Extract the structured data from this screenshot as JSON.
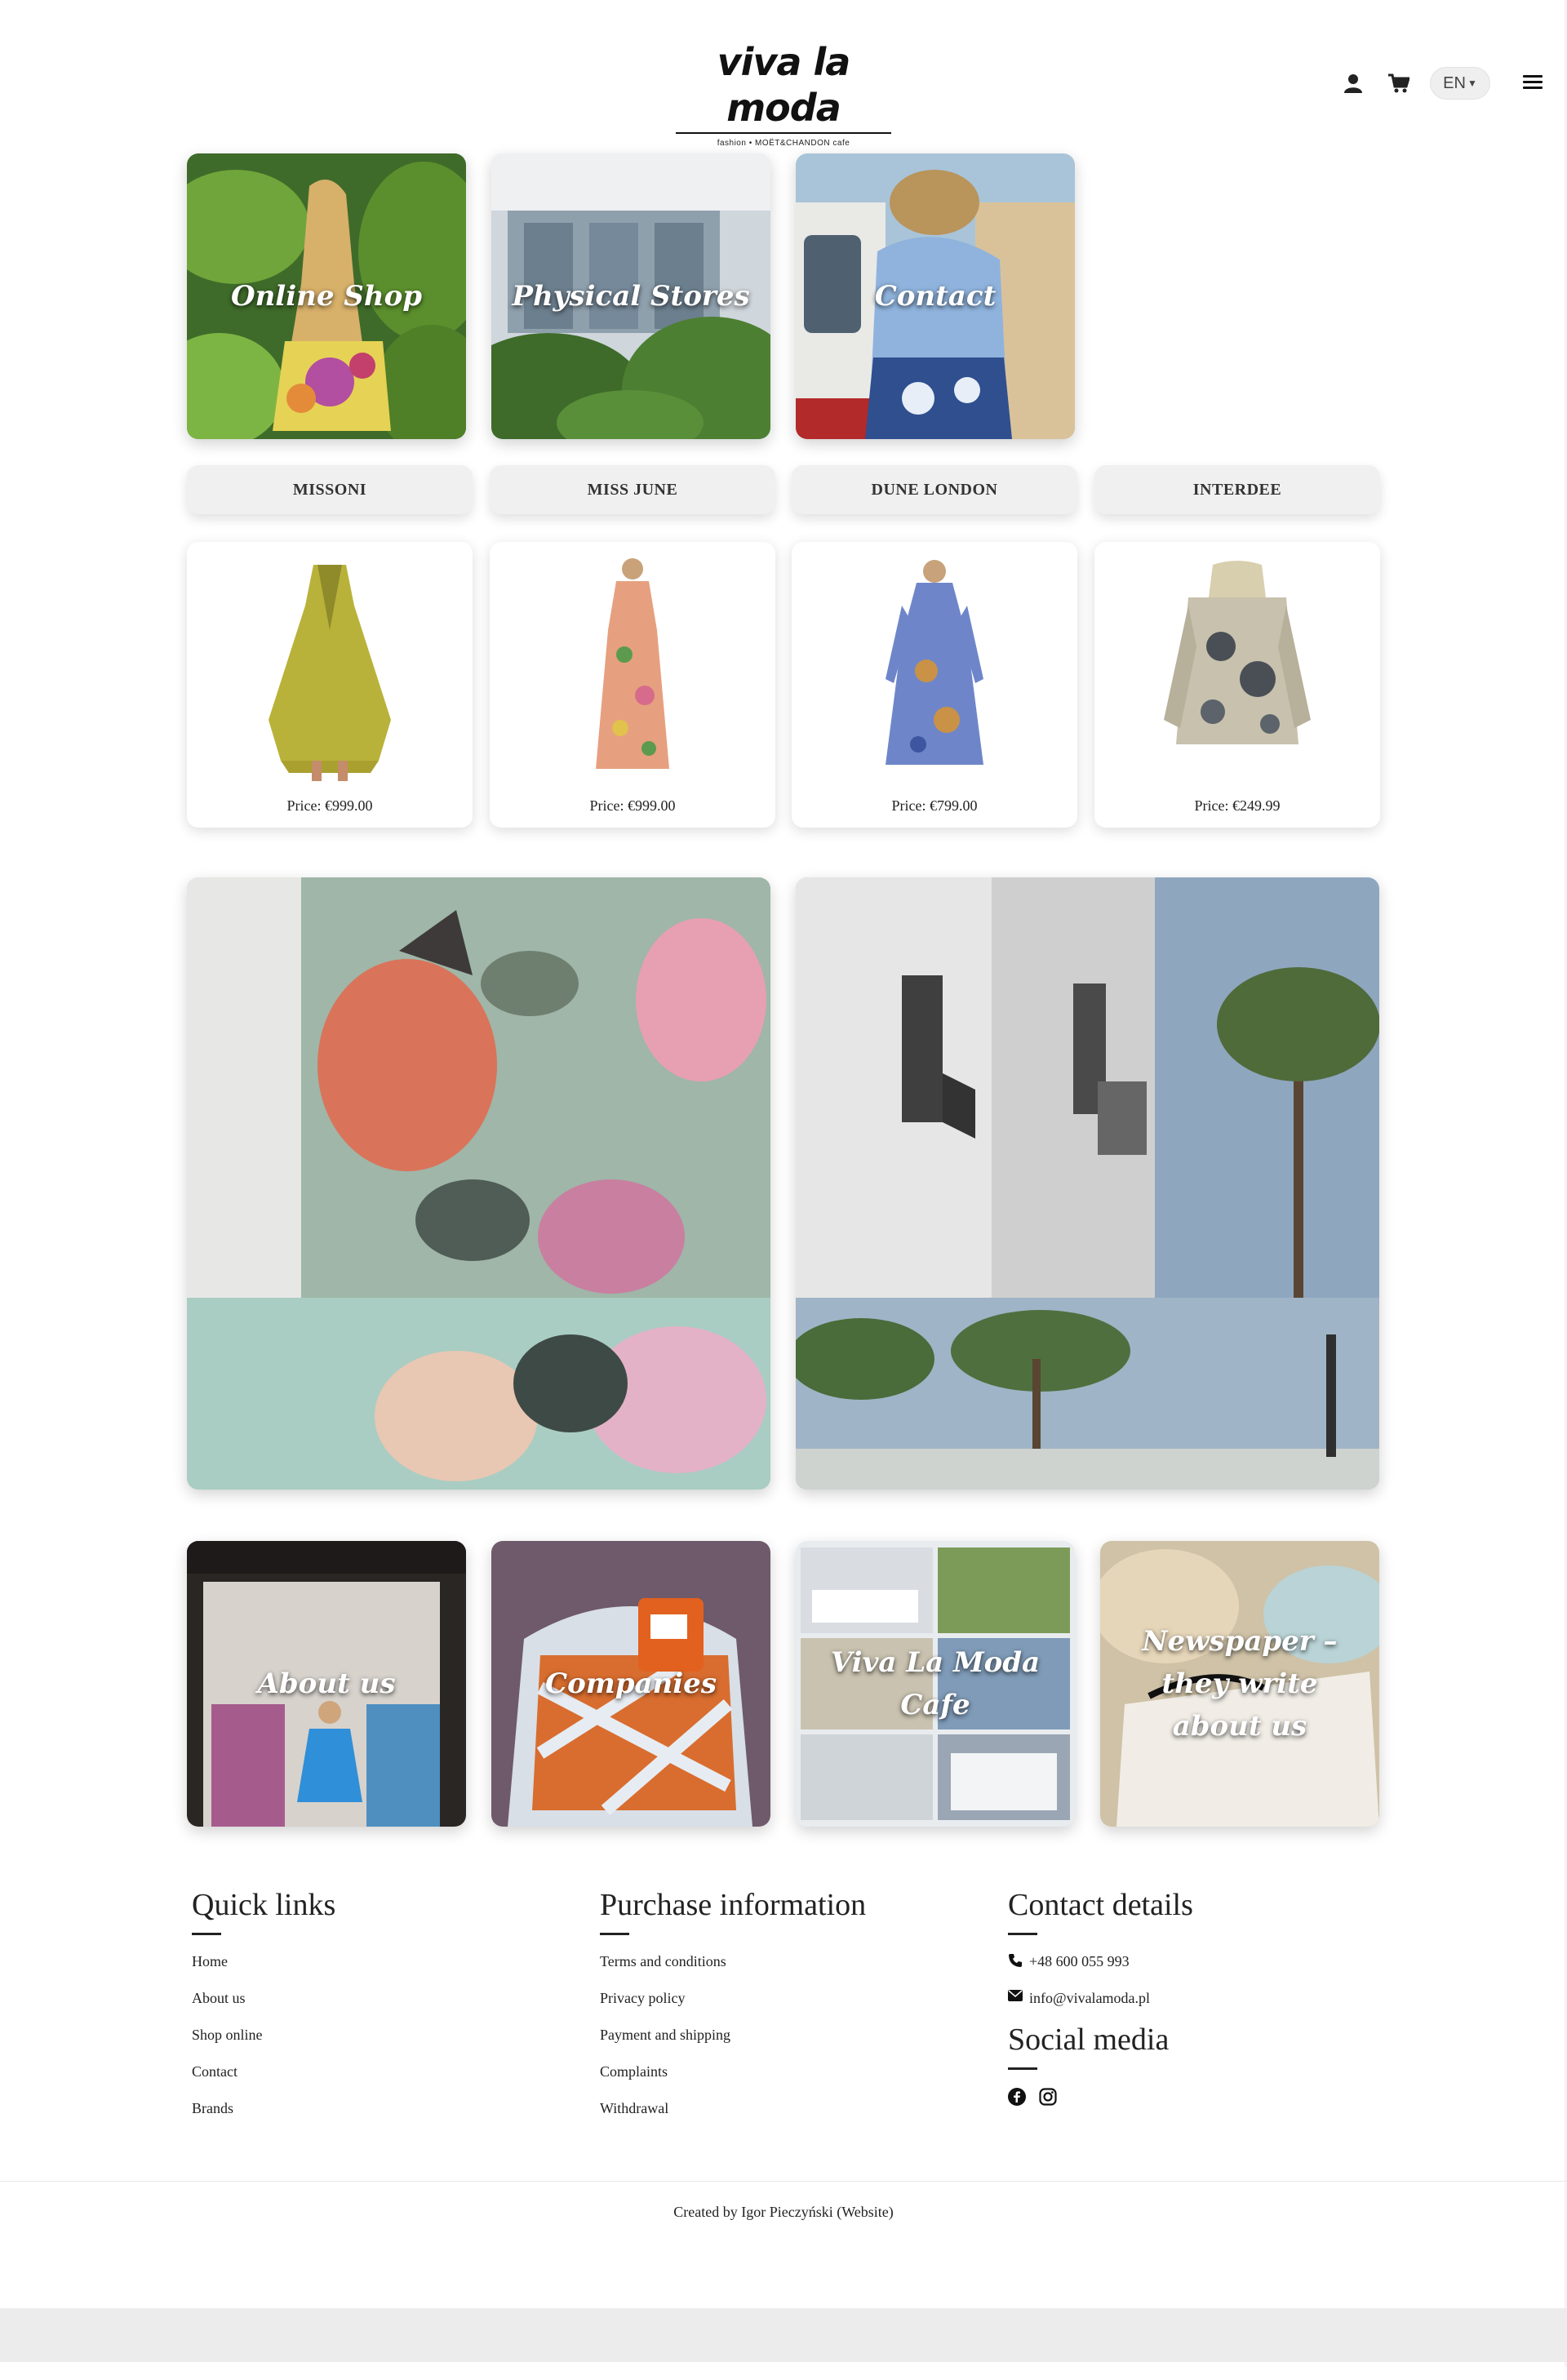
{
  "header": {
    "logo_text": "viva la moda",
    "logo_tagline": "fashion • MOËT&CHANDON cafe",
    "language": "EN",
    "icons": [
      "user-icon",
      "cart-icon",
      "chevron-down-icon",
      "menu-icon"
    ]
  },
  "nav_tiles": [
    {
      "label": "Online Shop"
    },
    {
      "label": "Physical Stores"
    },
    {
      "label": "Contact"
    }
  ],
  "brands": [
    "MISSONI",
    "MISS JUNE",
    "DUNE LONDON",
    "INTERDEE"
  ],
  "products": [
    {
      "price": "Price: €999.00"
    },
    {
      "price": "Price: €999.00"
    },
    {
      "price": "Price: €799.00"
    },
    {
      "price": "Price: €249.99"
    }
  ],
  "bottom_tiles": [
    {
      "label": "About us"
    },
    {
      "label": "Companies"
    },
    {
      "label": "Viva La Moda Cafe"
    },
    {
      "label": "Newspaper – they write about us"
    }
  ],
  "footer": {
    "quick_links": {
      "title": "Quick links",
      "items": [
        "Home",
        "About us",
        "Shop online",
        "Contact",
        "Brands"
      ]
    },
    "purchase": {
      "title": "Purchase information",
      "items": [
        "Terms and conditions",
        "Privacy policy",
        "Payment and shipping",
        "Complaints",
        "Withdrawal"
      ]
    },
    "contact": {
      "title": "Contact details",
      "phone": "+48 600 055 993",
      "email": "info@vivalamoda.pl"
    },
    "social": {
      "title": "Social media",
      "icons": [
        "facebook-icon",
        "instagram-icon"
      ]
    },
    "credit": "Created by Igor Pieczyński (Website)"
  }
}
